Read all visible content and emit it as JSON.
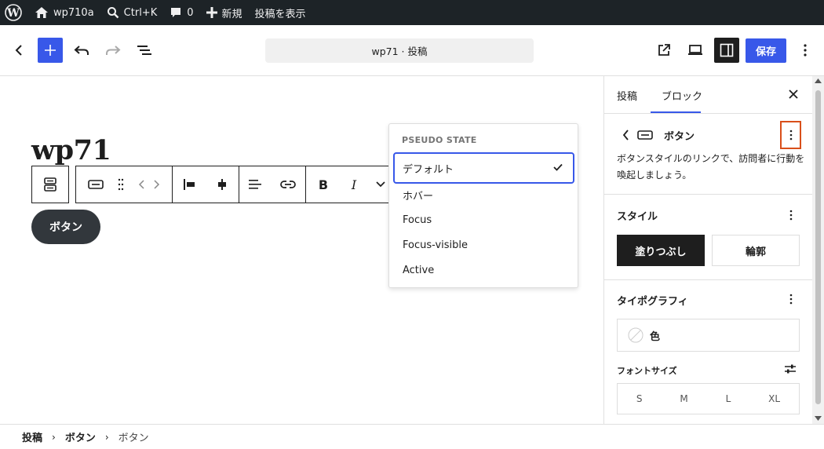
{
  "admin_bar": {
    "site_name": "wp710a",
    "shortcut": "Ctrl+K",
    "comments_count": "0",
    "new_label": "新規",
    "view_post_label": "投稿を表示"
  },
  "editor_header": {
    "document_title": "wp71 · 投稿",
    "save_label": "保存"
  },
  "canvas": {
    "post_title": "wp71",
    "button_text": "ボタン"
  },
  "pseudo_state_menu": {
    "heading": "PSEUDO STATE",
    "items": [
      "デフォルト",
      "ホバー",
      "Focus",
      "Focus-visible",
      "Active"
    ],
    "selected": "デフォルト"
  },
  "sidebar": {
    "tabs": [
      "投稿",
      "ブロック"
    ],
    "active_tab": "ブロック",
    "block_name": "ボタン",
    "block_description": "ボタンスタイルのリンクで、訪問者に行動を喚起しましょう。",
    "style_section": "スタイル",
    "styles": [
      "塗りつぶし",
      "輪郭"
    ],
    "active_style": "塗りつぶし",
    "typography_section": "タイポグラフィ",
    "color_label": "色",
    "font_size_label": "フォントサイズ",
    "font_sizes": [
      "S",
      "M",
      "L",
      "XL"
    ]
  },
  "breadcrumb": [
    "投稿",
    "ボタン",
    "ボタン"
  ],
  "colors": {
    "accent": "#3858e9",
    "admin_bar_bg": "#1d2327",
    "button_bg": "#32373c",
    "highlight_border": "#d94f1a"
  }
}
